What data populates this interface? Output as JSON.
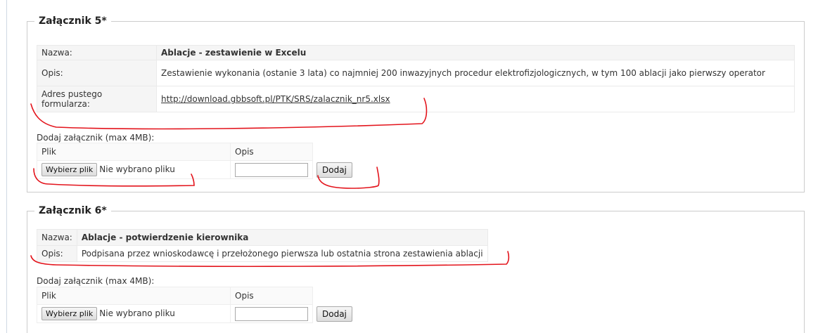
{
  "attachments": [
    {
      "legend": "Załącznik 5*",
      "name_label": "Nazwa:",
      "name_value": "Ablacje - zestawienie w Excelu",
      "desc_label": "Opis:",
      "desc_value": "Zestawienie wykonania (ostanie 3 lata) co najmniej 200 inwazyjnych procedur elektrofizjologicznych, w tym 100 ablacji jako pierwszy operator",
      "form_label": "Adres pustego formularza:",
      "form_link": "http://download.gbbsoft.pl/PTK/SRS/zalacznik_nr5.xlsx",
      "add_label": "Dodaj załącznik (max 4MB):",
      "col_file": "Plik",
      "col_desc": "Opis",
      "choose_button": "Wybierz plik",
      "no_file": "Nie wybrano pliku",
      "add_button": "Dodaj"
    },
    {
      "legend": "Załącznik 6*",
      "name_label": "Nazwa:",
      "name_value": "Ablacje - potwierdzenie kierownika",
      "desc_label": "Opis:",
      "desc_value": "Podpisana przez wnioskodawcę i przełożonego pierwsza lub ostatnia strona zestawienia ablacji",
      "add_label": "Dodaj załącznik (max 4MB):",
      "col_file": "Plik",
      "col_desc": "Opis",
      "choose_button": "Wybierz plik",
      "no_file": "Nie wybrano pliku",
      "add_button": "Dodaj"
    }
  ],
  "annotation_color": "#e3141c"
}
